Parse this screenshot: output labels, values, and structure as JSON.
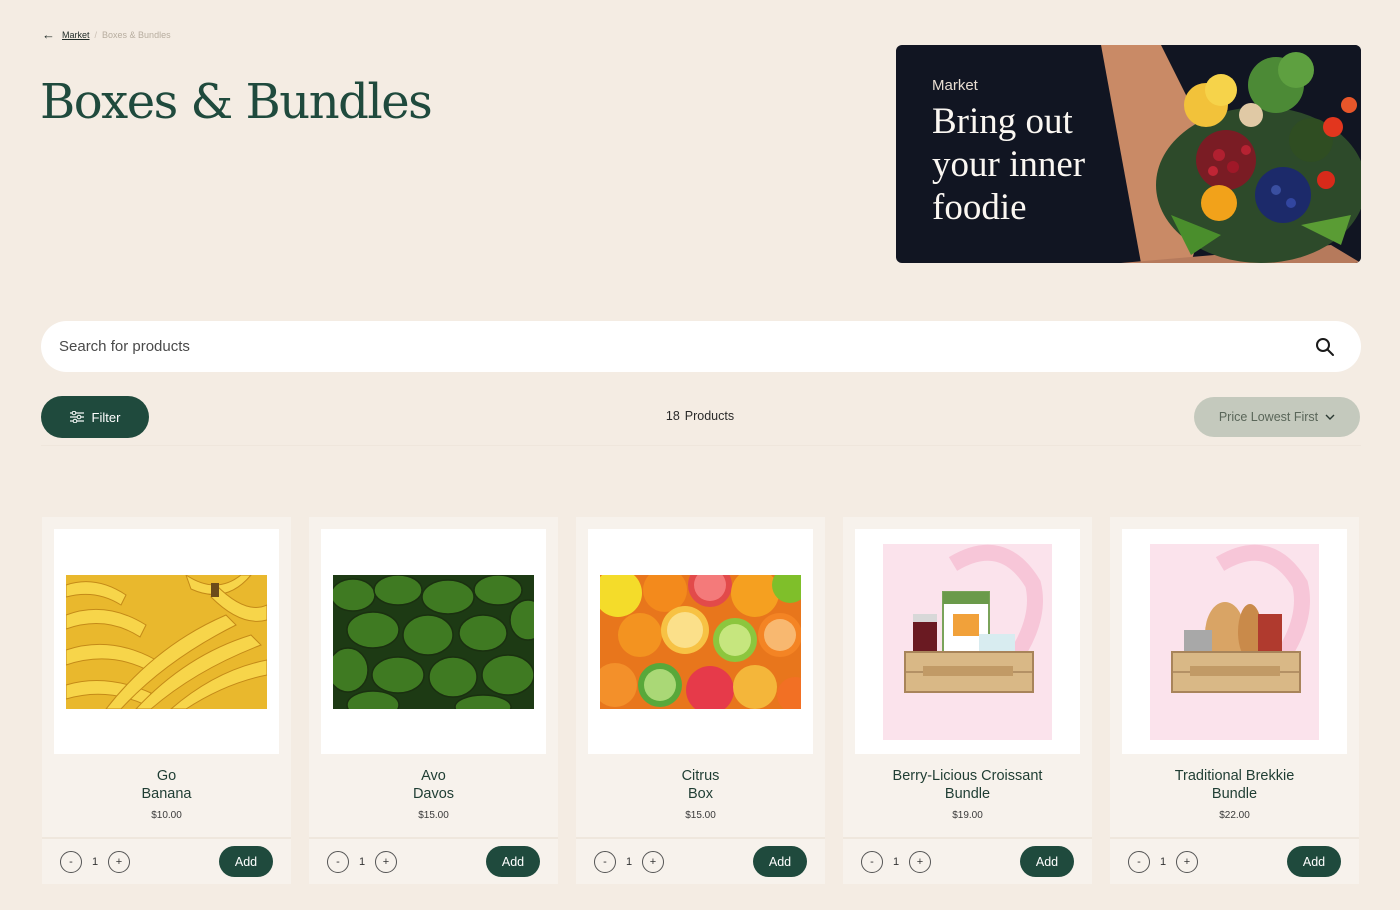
{
  "breadcrumb": {
    "parent": "Market",
    "separator": "/",
    "current": "Boxes & Bundles"
  },
  "page_title": "Boxes & Bundles",
  "promo": {
    "eyebrow": "Market",
    "headline": "Bring out your inner foodie",
    "image_icon": "vegetables-bowl-photo"
  },
  "search": {
    "placeholder": "Search for products",
    "icon": "search-icon"
  },
  "toolbar": {
    "filter_label": "Filter",
    "filter_icon": "sliders-icon",
    "count": "18",
    "count_label": "Products",
    "sort_label": "Price Lowest First",
    "sort_icon": "chevron-down-icon"
  },
  "products": [
    {
      "name_line1": "Go",
      "name_line2": "Banana",
      "price": "$10.00",
      "qty": "1",
      "add_label": "Add",
      "image": "bananas-photo"
    },
    {
      "name_line1": "Avo",
      "name_line2": "Davos",
      "price": "$15.00",
      "qty": "1",
      "add_label": "Add",
      "image": "avocados-photo"
    },
    {
      "name_line1": "Citrus",
      "name_line2": "Box",
      "price": "$15.00",
      "qty": "1",
      "add_label": "Add",
      "image": "citrus-photo"
    },
    {
      "name_line1": "Berry-Licious Croissant",
      "name_line2": "Bundle",
      "price": "$19.00",
      "qty": "1",
      "add_label": "Add",
      "image": "croissant-crate-photo"
    },
    {
      "name_line1": "Traditional Brekkie",
      "name_line2": "Bundle",
      "price": "$22.00",
      "qty": "1",
      "add_label": "Add",
      "image": "brekkie-crate-photo"
    }
  ],
  "qty_minus": "-",
  "qty_plus": "+",
  "colors": {
    "background": "#f4ece3",
    "primary": "#1f4a3d",
    "promo_bg": "#111522",
    "sort_bg": "#c4c9bd"
  }
}
